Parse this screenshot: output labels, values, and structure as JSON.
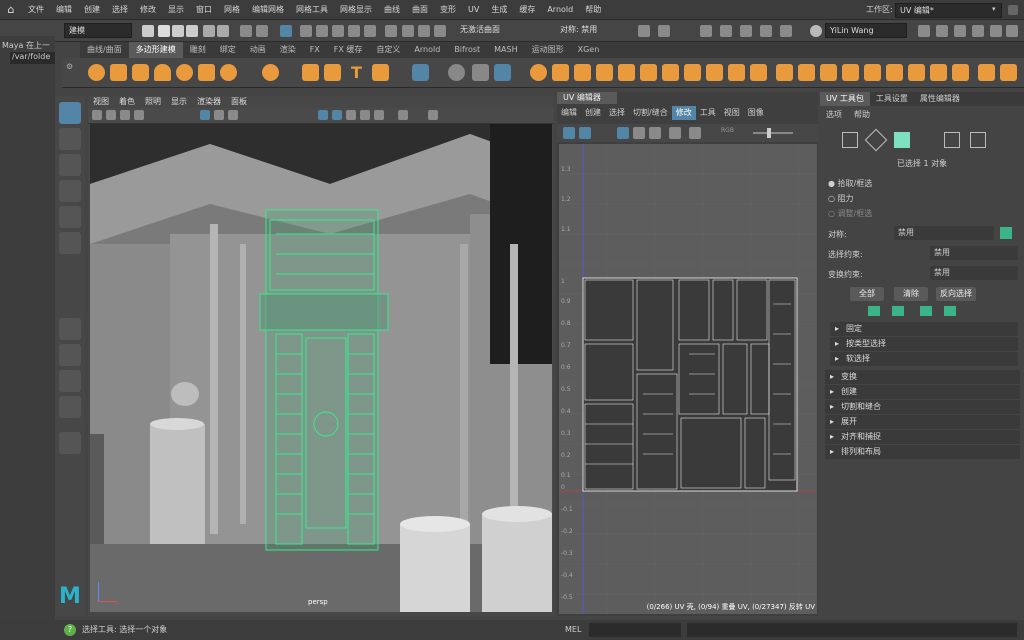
{
  "menubar": {
    "items": [
      "文件",
      "编辑",
      "创建",
      "选择",
      "修改",
      "显示",
      "窗口",
      "网格",
      "编辑网格",
      "网格工具",
      "网格显示",
      "曲线",
      "曲面",
      "变形",
      "UV",
      "生成",
      "缓存",
      "Arnold",
      "帮助"
    ],
    "workspace_label": "工作区:",
    "workspace_value": "UV 编辑*"
  },
  "statusline": {
    "mode": "建模",
    "live_surface": "无激活曲面",
    "symmetry": "对称: 禁用",
    "user": "YiLin Wang"
  },
  "outliner": {
    "line1": "Maya 在上一",
    "line2": "/var/folde"
  },
  "shelf": {
    "tabs": [
      "曲线/曲面",
      "多边形建模",
      "雕刻",
      "绑定",
      "动画",
      "渲染",
      "FX",
      "FX 缓存",
      "自定义",
      "Arnold",
      "Bifrost",
      "MASH",
      "运动图形",
      "XGen"
    ],
    "active_tab": "多边形建模"
  },
  "viewport": {
    "menu": [
      "视图",
      "着色",
      "照明",
      "显示",
      "渲染器",
      "面板"
    ],
    "camera_label": "persp"
  },
  "uv_editor": {
    "title": "UV 编辑器",
    "menu": [
      "编辑",
      "创建",
      "选择",
      "切割/缝合",
      "修改",
      "工具",
      "视图",
      "图像"
    ],
    "active_menu": "修改",
    "rgb_label": "RGB",
    "y_ticks": [
      "1.3",
      "1.2",
      "1.1",
      "1",
      "0.9",
      "0.8",
      "0.7",
      "0.6",
      "0.5",
      "0.4",
      "0.3",
      "0.2",
      "0.1",
      "0",
      "-0.1",
      "-0.2",
      "-0.3",
      "-0.4",
      "-0.5"
    ],
    "stats": "(0/266) UV 壳, (0/94) 重叠 UV, (0/27347) 反转 UV"
  },
  "uv_toolkit": {
    "tabs": [
      "UV 工具包",
      "工具设置",
      "属性编辑器"
    ],
    "menu": [
      "选项",
      "帮助"
    ],
    "selected_count": "已选择 1 对象",
    "pick_modes": [
      "拾取/框选",
      "阻力",
      "调整/框选"
    ],
    "symmetry_label": "对称:",
    "symmetry_value": "禁用",
    "select_constraint_label": "选择约束:",
    "select_constraint_value": "禁用",
    "transform_constraint_label": "变换约束:",
    "transform_constraint_value": "禁用",
    "buttons": [
      "全部",
      "清除",
      "反向选择"
    ],
    "subsections": [
      "固定",
      "按类型选择",
      "软选择"
    ],
    "sections": [
      "变换",
      "创建",
      "切割和缝合",
      "展开",
      "对齐和捕捉",
      "排列和布局"
    ]
  },
  "helpline": {
    "text": "选择工具: 选择一个对象"
  },
  "mel": {
    "label": "MEL"
  },
  "colors": {
    "accent": "#5285a6",
    "wire_green": "#39e88f",
    "shelf_orange": "#e89a3c"
  }
}
